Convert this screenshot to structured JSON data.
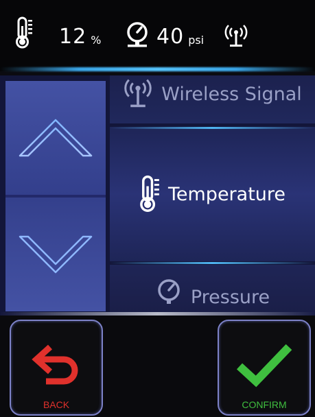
{
  "status": {
    "humidity": {
      "value": "12",
      "unit": "%",
      "icon": "thermometer-icon"
    },
    "pressure": {
      "value": "40",
      "unit": "psi",
      "icon": "gauge-icon"
    },
    "signal_icon": "wireless-signal-icon"
  },
  "menu": {
    "items": [
      {
        "label": "Wireless Signal",
        "icon": "wireless-signal-icon",
        "state": "previous"
      },
      {
        "label": "Temperature",
        "icon": "thermometer-icon",
        "state": "selected"
      },
      {
        "label": "Pressure",
        "icon": "gauge-icon",
        "state": "next"
      }
    ],
    "scroll_up_icon": "chevron-up-icon",
    "scroll_down_icon": "chevron-down-icon"
  },
  "footer": {
    "back_label": "BACK",
    "confirm_label": "CONFIRM"
  },
  "colors": {
    "back": "#e0312c",
    "confirm": "#3fbf3f",
    "accent_glow": "#4fb4f0",
    "panel": "#2a3376"
  }
}
